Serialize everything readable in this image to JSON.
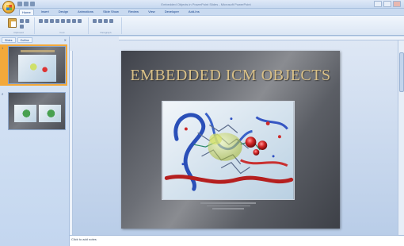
{
  "window": {
    "title": "Embedded Objects in PowerPoint Slides - Microsoft PowerPoint"
  },
  "ribbon": {
    "tabs": [
      {
        "label": "Home"
      },
      {
        "label": "Insert"
      },
      {
        "label": "Design"
      },
      {
        "label": "Animations"
      },
      {
        "label": "Slide Show"
      },
      {
        "label": "Review"
      },
      {
        "label": "View"
      },
      {
        "label": "Developer"
      },
      {
        "label": "Add-Ins"
      }
    ],
    "groups": {
      "clipboard": "Clipboard",
      "font": "Font",
      "paragraph": "Paragraph"
    }
  },
  "sidepanel": {
    "tabs": [
      {
        "label": "Slides"
      },
      {
        "label": "Outline"
      }
    ],
    "slides": [
      {
        "number": "1"
      },
      {
        "number": "2"
      }
    ]
  },
  "slide": {
    "title": "EMBEDDED ICM OBJECTS"
  },
  "notes": {
    "placeholder": "Click to add notes"
  },
  "icons": [
    "office-button-icon",
    "save-icon",
    "undo-icon",
    "redo-icon",
    "paste-icon",
    "close-icon"
  ]
}
